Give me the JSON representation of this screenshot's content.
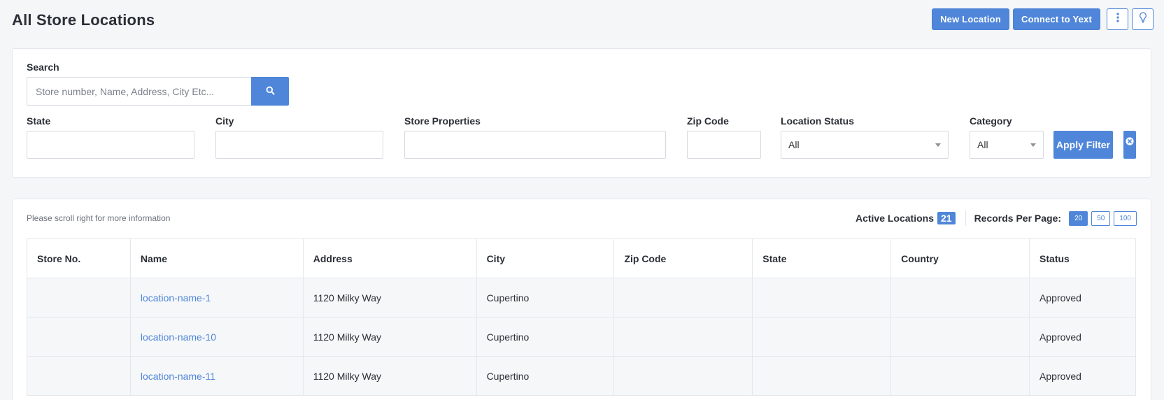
{
  "page": {
    "title": "All Store Locations"
  },
  "header": {
    "new_location": "New Location",
    "connect_yext": "Connect to Yext"
  },
  "filters": {
    "search": {
      "label": "Search",
      "placeholder": "Store number, Name, Address, City Etc..."
    },
    "state": {
      "label": "State",
      "value": ""
    },
    "city": {
      "label": "City",
      "value": ""
    },
    "store_properties": {
      "label": "Store Properties",
      "value": ""
    },
    "zip_code": {
      "label": "Zip Code",
      "value": ""
    },
    "location_status": {
      "label": "Location Status",
      "selected": "All"
    },
    "category": {
      "label": "Category",
      "selected": "All"
    },
    "apply_label": "Apply Filter"
  },
  "table_area": {
    "hint": "Please scroll right for more information",
    "active_locations_label": "Active Locations",
    "active_locations_count": "21",
    "records_per_page_label": "Records Per Page:",
    "per_page_options": [
      "20",
      "50",
      "100"
    ],
    "selected_per_page": "20"
  },
  "table": {
    "columns": [
      "Store No.",
      "Name",
      "Address",
      "City",
      "Zip Code",
      "State",
      "Country",
      "Status"
    ],
    "rows": [
      [
        "",
        "location-name-1",
        "1120 Milky Way",
        "Cupertino",
        "",
        "",
        "",
        "Approved"
      ],
      [
        "",
        "location-name-10",
        "1120 Milky Way",
        "Cupertino",
        "",
        "",
        "",
        "Approved"
      ],
      [
        "",
        "location-name-11",
        "1120 Milky Way",
        "Cupertino",
        "",
        "",
        "",
        "Approved"
      ]
    ]
  },
  "icons": {
    "more": "vertical-dots-icon",
    "hint": "lightbulb-icon",
    "search": "search-icon",
    "clear": "close-circle-icon"
  },
  "colors": {
    "accent": "#4f86d9",
    "link": "#4f86d9"
  }
}
